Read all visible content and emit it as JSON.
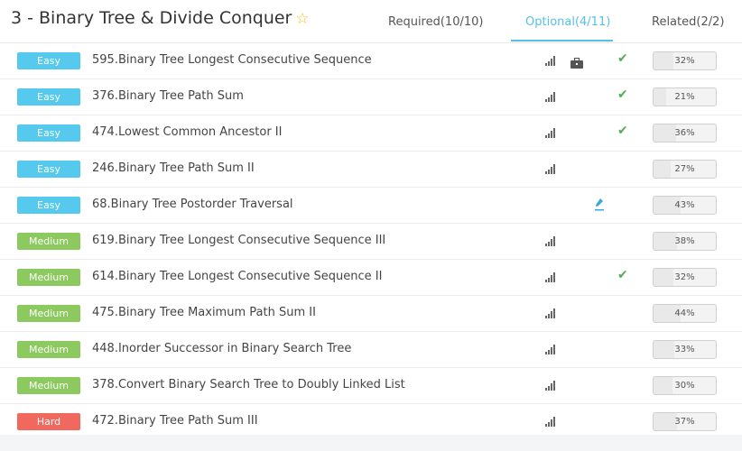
{
  "header": {
    "title": "3 - Binary Tree & Divide Conquer",
    "star_icon": "star-icon",
    "tabs": [
      {
        "label": "Required(10/10)",
        "active": false
      },
      {
        "label": "Optional(4/11)",
        "active": true
      },
      {
        "label": "Related(2/2)",
        "active": false
      }
    ]
  },
  "colors": {
    "accent": "#56c1e6",
    "easy": "#56c9ee",
    "medium": "#8cca5f",
    "hard": "#f0685e",
    "check": "#4caf50"
  },
  "problems": [
    {
      "difficulty": "Easy",
      "title": "595.Binary Tree Longest Consecutive Sequence",
      "signal": true,
      "briefcase": true,
      "note": false,
      "check": true,
      "percent": "32%"
    },
    {
      "difficulty": "Easy",
      "title": "376.Binary Tree Path Sum",
      "signal": true,
      "briefcase": false,
      "note": false,
      "check": true,
      "percent": "21%"
    },
    {
      "difficulty": "Easy",
      "title": "474.Lowest Common Ancestor II",
      "signal": true,
      "briefcase": false,
      "note": false,
      "check": true,
      "percent": "36%"
    },
    {
      "difficulty": "Easy",
      "title": "246.Binary Tree Path Sum II",
      "signal": true,
      "briefcase": false,
      "note": false,
      "check": false,
      "percent": "27%"
    },
    {
      "difficulty": "Easy",
      "title": "68.Binary Tree Postorder Traversal",
      "signal": false,
      "briefcase": false,
      "note": true,
      "check": false,
      "percent": "43%"
    },
    {
      "difficulty": "Medium",
      "title": "619.Binary Tree Longest Consecutive Sequence III",
      "signal": true,
      "briefcase": false,
      "note": false,
      "check": false,
      "percent": "38%"
    },
    {
      "difficulty": "Medium",
      "title": "614.Binary Tree Longest Consecutive Sequence II",
      "signal": true,
      "briefcase": false,
      "note": false,
      "check": true,
      "percent": "32%"
    },
    {
      "difficulty": "Medium",
      "title": "475.Binary Tree Maximum Path Sum II",
      "signal": true,
      "briefcase": false,
      "note": false,
      "check": false,
      "percent": "44%"
    },
    {
      "difficulty": "Medium",
      "title": "448.Inorder Successor in Binary Search Tree",
      "signal": true,
      "briefcase": false,
      "note": false,
      "check": false,
      "percent": "33%"
    },
    {
      "difficulty": "Medium",
      "title": "378.Convert Binary Search Tree to Doubly Linked List",
      "signal": true,
      "briefcase": false,
      "note": false,
      "check": false,
      "percent": "30%"
    },
    {
      "difficulty": "Hard",
      "title": "472.Binary Tree Path Sum III",
      "signal": true,
      "briefcase": false,
      "note": false,
      "check": false,
      "percent": "37%"
    }
  ]
}
